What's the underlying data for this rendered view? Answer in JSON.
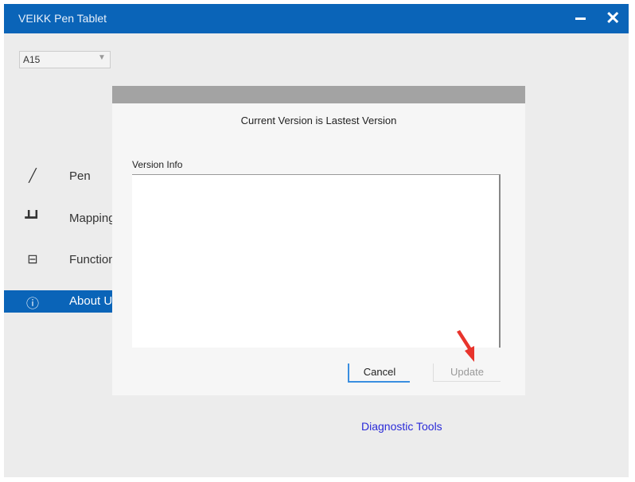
{
  "window": {
    "title": "VEIKK Pen Tablet"
  },
  "device_select": {
    "value": "A15"
  },
  "sidebar": {
    "items": [
      {
        "label": "Pen",
        "icon": "pen-icon"
      },
      {
        "label": "Mapping",
        "icon": "mapping-icon"
      },
      {
        "label": "Function",
        "icon": "function-icon"
      },
      {
        "label": "About Us",
        "icon": "info-icon",
        "active": true
      }
    ]
  },
  "dialog": {
    "message": "Current Version is Lastest Version",
    "version_info_label": "Version Info",
    "version_info_value": "",
    "cancel_label": "Cancel",
    "update_label": "Update"
  },
  "footer": {
    "diagnostic_link": "Diagnostic Tools"
  },
  "colors": {
    "accent": "#0a64b8",
    "annotation_arrow": "#e8342c"
  }
}
